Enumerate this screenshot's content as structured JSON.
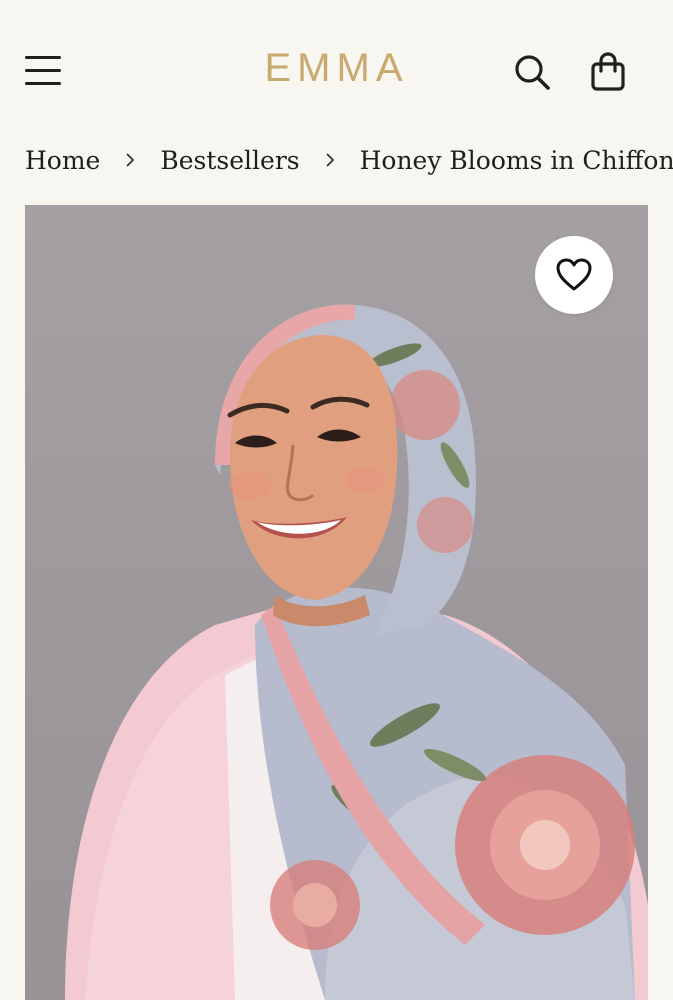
{
  "header": {
    "logo_text": "EMMA",
    "menu_icon": "hamburger-menu-icon",
    "search_icon": "search-icon",
    "cart_icon": "shopping-bag-icon"
  },
  "breadcrumb": {
    "items": [
      "Home",
      "Bestsellers"
    ],
    "current": "Honey Blooms in Chiffon",
    "separator_icon": "chevron-right-icon"
  },
  "product": {
    "favorite_icon": "heart-icon",
    "colors": {
      "background": "#f7f6f1",
      "logo": "#c9a96e",
      "scarf_base": "#b6bccd",
      "scarf_flower": "#d7807c",
      "cardigan": "#f3c9d2"
    }
  }
}
